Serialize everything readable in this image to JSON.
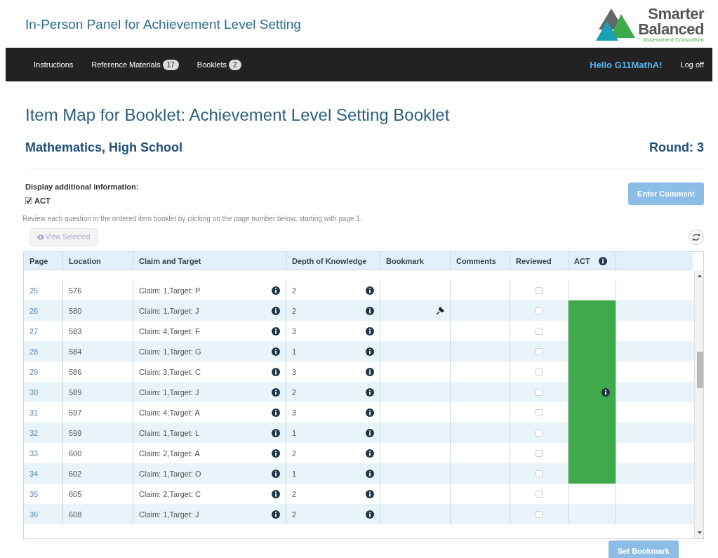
{
  "header": {
    "title": "In-Person Panel for Achievement Level Setting",
    "logo": {
      "line1": "Smarter",
      "line2": "Balanced",
      "line3": "Assessment Consortium"
    }
  },
  "nav": {
    "items": [
      {
        "label": "Instructions"
      },
      {
        "label": "Reference Materials",
        "badge": "17"
      },
      {
        "label": "Booklets",
        "badge": "2"
      }
    ],
    "greeting": "Hello G11MathA!",
    "logoff": "Log off"
  },
  "page_title": "Item Map for Booklet: Achievement Level Setting Booklet",
  "subject": "Mathematics, High School",
  "round": "Round: 3",
  "display_label": "Display additional information:",
  "options": [
    {
      "label": "ACT",
      "checked": true
    }
  ],
  "enter_comment": "Enter Comment",
  "instructions": "Review each question in the ordered item booklet by clicking on the page number below, starting with page 1.",
  "view_selected": "View Selected",
  "table": {
    "columns": [
      "Page",
      "Location",
      "Claim and Target",
      "Depth of Knowledge",
      "Bookmark",
      "Comments",
      "Reviewed",
      "ACT"
    ],
    "rows": [
      {
        "page": "25",
        "location": "576",
        "claim": "Claim: 1,Target: P",
        "dok": "2",
        "bookmarked": false,
        "reviewed": false,
        "act": false
      },
      {
        "page": "26",
        "location": "580",
        "claim": "Claim: 1,Target: J",
        "dok": "2",
        "bookmarked": true,
        "reviewed": false,
        "act": true
      },
      {
        "page": "27",
        "location": "583",
        "claim": "Claim: 4,Target: F",
        "dok": "3",
        "bookmarked": false,
        "reviewed": false,
        "act": true
      },
      {
        "page": "28",
        "location": "584",
        "claim": "Claim: 1,Target: G",
        "dok": "1",
        "bookmarked": false,
        "reviewed": false,
        "act": true
      },
      {
        "page": "29",
        "location": "586",
        "claim": "Claim: 3,Target: C",
        "dok": "3",
        "bookmarked": false,
        "reviewed": false,
        "act": true
      },
      {
        "page": "30",
        "location": "589",
        "claim": "Claim: 1,Target: J",
        "dok": "2",
        "bookmarked": false,
        "reviewed": false,
        "act": true
      },
      {
        "page": "31",
        "location": "597",
        "claim": "Claim: 4,Target: A",
        "dok": "3",
        "bookmarked": false,
        "reviewed": false,
        "act": true
      },
      {
        "page": "32",
        "location": "599",
        "claim": "Claim: 1,Target: L",
        "dok": "1",
        "bookmarked": false,
        "reviewed": false,
        "act": true
      },
      {
        "page": "33",
        "location": "600",
        "claim": "Claim: 2,Target: A",
        "dok": "2",
        "bookmarked": false,
        "reviewed": false,
        "act": true
      },
      {
        "page": "34",
        "location": "602",
        "claim": "Claim: 1,Target: O",
        "dok": "1",
        "bookmarked": false,
        "reviewed": false,
        "act": true
      },
      {
        "page": "35",
        "location": "605",
        "claim": "Claim: 2,Target: C",
        "dok": "2",
        "bookmarked": false,
        "reviewed": false,
        "act": false
      },
      {
        "page": "36",
        "location": "608",
        "claim": "Claim: 1,Target: J",
        "dok": "2",
        "bookmarked": false,
        "reviewed": false,
        "act": false
      }
    ]
  },
  "set_bookmark": "Set Bookmark"
}
